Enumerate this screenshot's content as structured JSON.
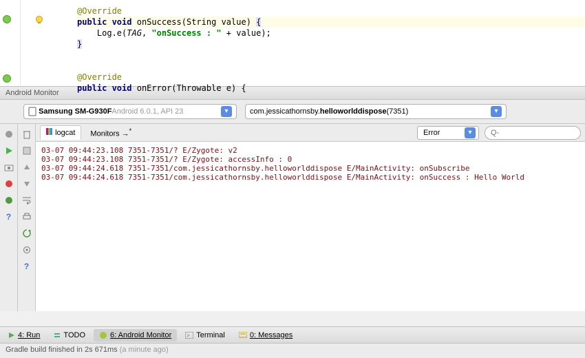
{
  "editor": {
    "annotation": "@Override",
    "method_sig_prefix": "public void",
    "method1_name": "onSuccess",
    "method1_paramtype": "String",
    "method1_paramname": "value",
    "log_call": "Log.e",
    "log_tag": "TAG",
    "log_msg": "\"onSuccess : \"",
    "log_plus": " + value);",
    "method2_name": "onError",
    "method2_paramtype": "Throwable",
    "method2_paramname": "e"
  },
  "panel": {
    "title": "Android Monitor"
  },
  "device": {
    "name": "Samsung SM-G930F",
    "os": " Android 6.0.1, API 23"
  },
  "process": {
    "prefix": "com.jessicathornsby.",
    "bold": "helloworlddispose",
    "suffix": " (7351)"
  },
  "tabs": {
    "logcat": "logcat",
    "monitors": "Monitors"
  },
  "filter": {
    "level": "Error",
    "search_placeholder": "Q-"
  },
  "log_lines": [
    "03-07 09:44:23.108 7351-7351/? E/Zygote: v2",
    "03-07 09:44:23.108 7351-7351/? E/Zygote: accessInfo : 0",
    "03-07 09:44:24.618 7351-7351/com.jessicathornsby.helloworlddispose E/MainActivity: onSubscribe",
    "03-07 09:44:24.618 7351-7351/com.jessicathornsby.helloworlddispose E/MainActivity: onSuccess : Hello World"
  ],
  "bottom": {
    "run": "4: Run",
    "todo": "TODO",
    "monitor": "6: Android Monitor",
    "terminal": "Terminal",
    "messages": "0: Messages"
  },
  "status": {
    "main": "Gradle build finished in 2s 671ms ",
    "muted": "(a minute ago)"
  }
}
